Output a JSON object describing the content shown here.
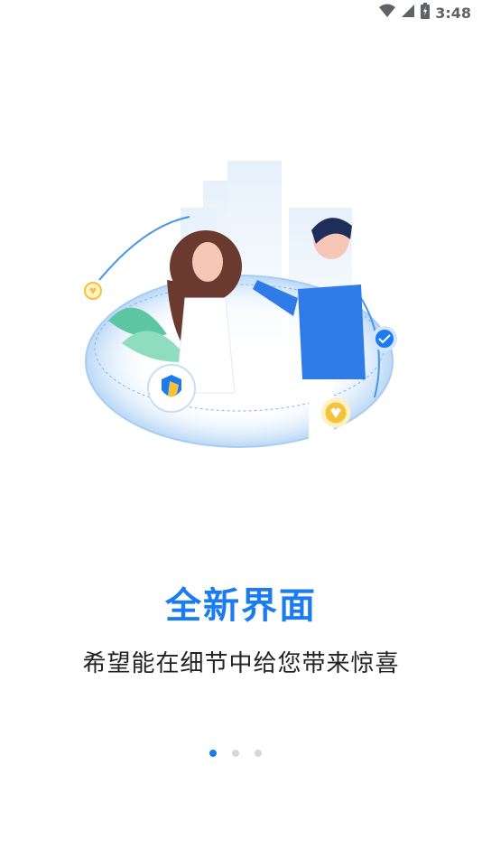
{
  "status_bar": {
    "time": "3:48",
    "icons": [
      "wifi-icon",
      "cellular-signal-icon",
      "battery-icon"
    ]
  },
  "onboarding": {
    "title": "全新界面",
    "subtitle": "希望能在细节中给您带来惊喜",
    "pager": {
      "total": 3,
      "active": 0
    }
  },
  "colors": {
    "accent": "#1a7cf0",
    "inactive_dot": "#d7d7d7",
    "text_primary": "#222222"
  }
}
